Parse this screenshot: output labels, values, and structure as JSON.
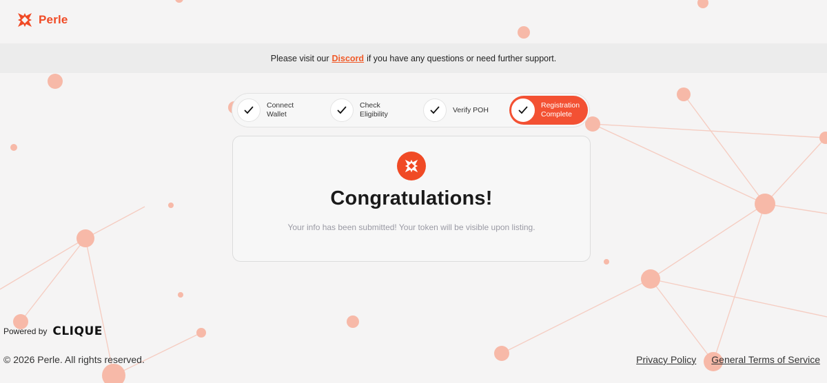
{
  "brand": {
    "name": "Perle",
    "logo_icon": "perle-logo-icon",
    "accent": "#f04a25"
  },
  "banner": {
    "prefix": "Please visit our",
    "link": "Discord",
    "suffix": "if you have any questions or need further support."
  },
  "steps": [
    {
      "label": "Connect\nWallet",
      "done": true,
      "active": false
    },
    {
      "label": "Check\nEligibility",
      "done": true,
      "active": false
    },
    {
      "label": "Verify POH",
      "done": true,
      "active": false
    },
    {
      "label": "Registration\nComplete",
      "done": true,
      "active": true
    }
  ],
  "card": {
    "title": "Congratulations!",
    "message": "Your info has been submitted! Your token will be visible upon listing."
  },
  "footer": {
    "powered_by": "Powered by",
    "powered_brand": "CLIQUE",
    "copyright": "© 2026 Perle. All rights reserved.",
    "links": [
      "Privacy Policy",
      "General Terms of Service"
    ]
  }
}
